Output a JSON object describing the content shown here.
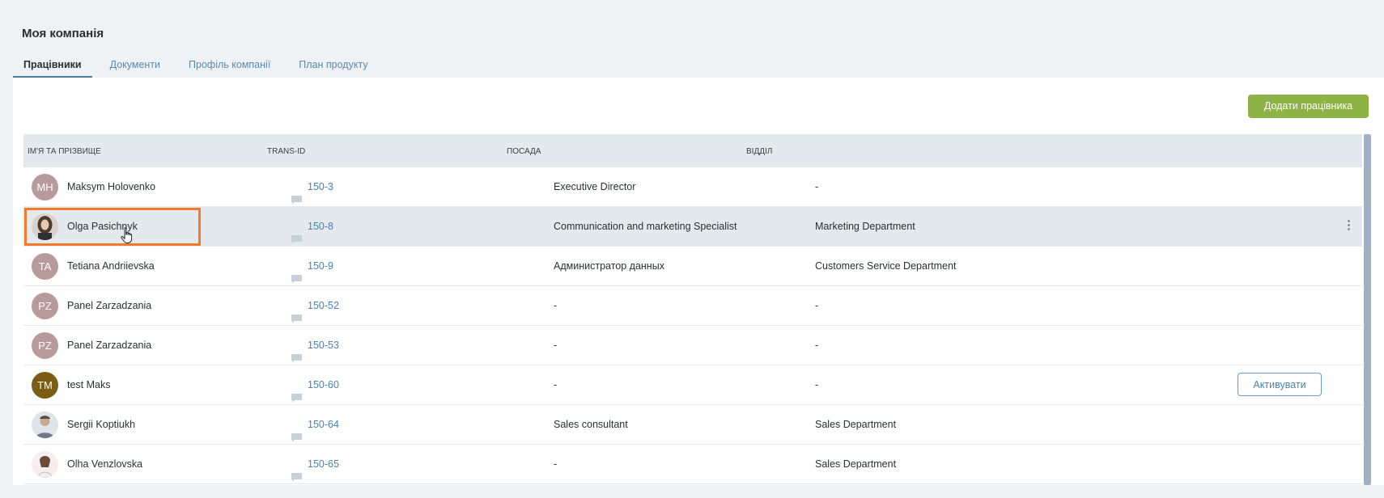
{
  "header": {
    "title": "Моя компанія",
    "tabs": [
      {
        "label": "Працівники",
        "active": true
      },
      {
        "label": "Документи",
        "active": false
      },
      {
        "label": "Профіль компанії",
        "active": false
      },
      {
        "label": "План продукту",
        "active": false
      }
    ]
  },
  "toolbar": {
    "add_employee_label": "Додати працівника"
  },
  "table": {
    "columns": [
      "ІМ'Я ТА ПРІЗВИЩЕ",
      "TRANS-ID",
      "ПОСАДА",
      "ВІДДІЛ"
    ],
    "rows": [
      {
        "initials": "MH",
        "avatar_color": "#b99a9a",
        "name": "Maksym Holovenko",
        "trans_id": "150-3",
        "position": "Executive Director",
        "department": "-"
      },
      {
        "initials": "",
        "avatar_color": "#6b5a4e",
        "name": "Olga Pasichnyk",
        "trans_id": "150-8",
        "position": "Communication and marketing Specialist",
        "department": "Marketing Department"
      },
      {
        "initials": "TA",
        "avatar_color": "#b99a9a",
        "name": "Tetiana Andriievska",
        "trans_id": "150-9",
        "position": "Администратор данных",
        "department": "Customers Service Department"
      },
      {
        "initials": "PZ",
        "avatar_color": "#b99a9a",
        "name": "Panel Zarzadzania",
        "trans_id": "150-52",
        "position": "-",
        "department": "-"
      },
      {
        "initials": "PZ",
        "avatar_color": "#b99a9a",
        "name": "Panel Zarzadzania",
        "trans_id": "150-53",
        "position": "-",
        "department": "-"
      },
      {
        "initials": "TM",
        "avatar_color": "#7a5c12",
        "name": "test Maks",
        "trans_id": "150-60",
        "position": "-",
        "department": "-"
      },
      {
        "initials": "",
        "avatar_color": "#8a9aa6",
        "name": "Sergii Koptiukh",
        "trans_id": "150-64",
        "position": "Sales consultant",
        "department": "Sales Department"
      },
      {
        "initials": "",
        "avatar_color": "#e8d8d8",
        "name": "Olha Venzlovska",
        "trans_id": "150-65",
        "position": "-",
        "department": "Sales Department"
      }
    ],
    "activate_label": "Активувати"
  },
  "colors": {
    "accent": "#8db346",
    "link": "#4a82b5",
    "highlight": "#f07c2b"
  }
}
